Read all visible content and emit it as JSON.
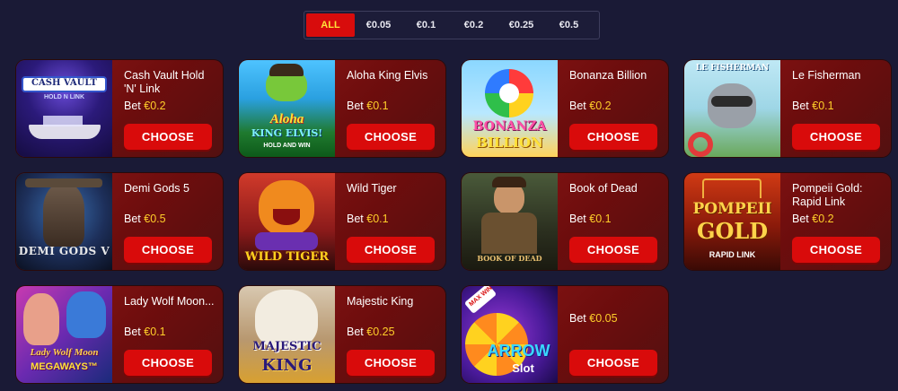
{
  "filters": [
    "ALL",
    "€0.05",
    "€0.1",
    "€0.2",
    "€0.25",
    "€0.5"
  ],
  "active_filter": "ALL",
  "bet_label": "Bet",
  "choose_label": "CHOOSE",
  "colors": {
    "accent_red": "#d80c0c",
    "bet_yellow": "#ffcf2a",
    "background": "#1a1a36"
  },
  "games": [
    {
      "name": "Cash Vault Hold 'N' Link",
      "bet": "€0.2",
      "thumb_text": [
        "CASH VAULT",
        "HOLD N LINK"
      ]
    },
    {
      "name": "Aloha King Elvis",
      "bet": "€0.1",
      "thumb_text": [
        "Aloha",
        "KING ELVIS!",
        "HOLD AND WIN"
      ]
    },
    {
      "name": "Bonanza Billion",
      "bet": "€0.2",
      "thumb_text": [
        "BONANZA",
        "BILLION"
      ]
    },
    {
      "name": "Le Fisherman",
      "bet": "€0.1",
      "thumb_text": [
        "LE FISHERMAN"
      ]
    },
    {
      "name": "Demi Gods 5",
      "bet": "€0.5",
      "thumb_text": [
        "DEMI GODS V"
      ]
    },
    {
      "name": "Wild Tiger",
      "bet": "€0.1",
      "thumb_text": [
        "WILD TIGER"
      ]
    },
    {
      "name": "Book of Dead",
      "bet": "€0.1",
      "thumb_text": [
        "BOOK OF DEAD"
      ]
    },
    {
      "name": "Pompeii Gold: Rapid Link",
      "bet": "€0.2",
      "thumb_text": [
        "POMPEII",
        "GOLD",
        "RAPID LINK"
      ]
    },
    {
      "name": "Lady Wolf Moon...",
      "bet": "€0.1",
      "thumb_text": [
        "Lady Wolf Moon",
        "MEGAWAYS™"
      ]
    },
    {
      "name": "Majestic King",
      "bet": "€0.25",
      "thumb_text": [
        "MAJESTIC",
        "KING"
      ]
    },
    {
      "name": "",
      "bet": "€0.05",
      "thumb_text": [
        "MAX WIN",
        "ARROW",
        "Slot"
      ]
    }
  ]
}
